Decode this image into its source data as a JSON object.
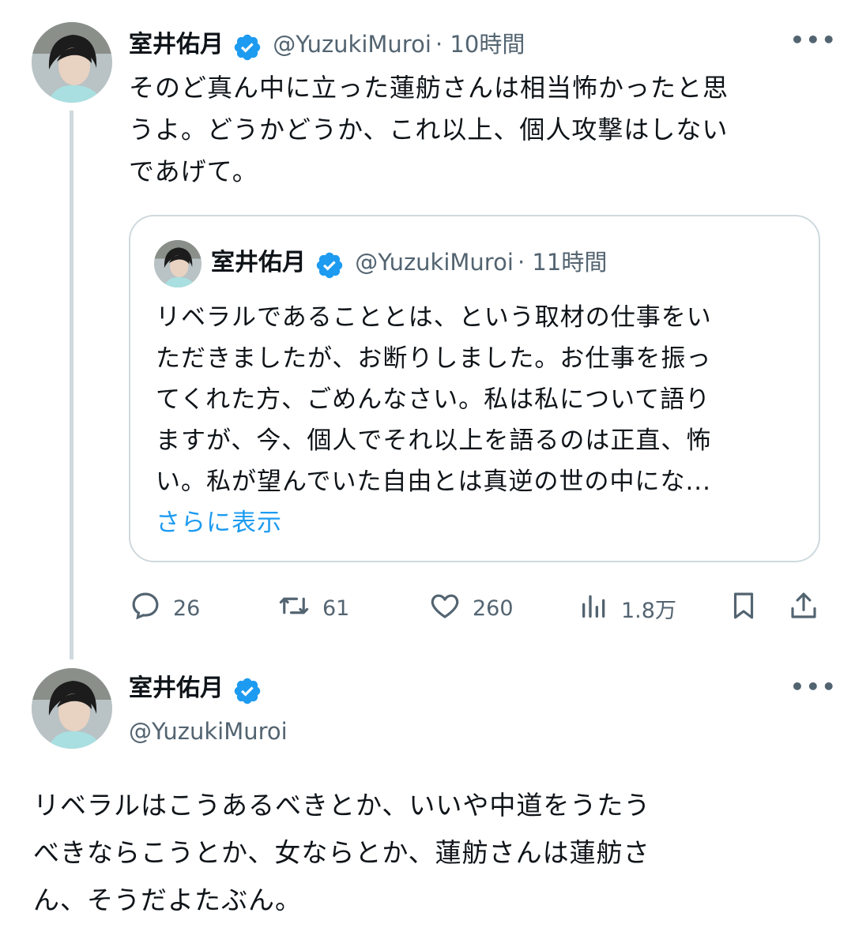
{
  "tweet1": {
    "display_name": "室井佑月",
    "handle": "@YuzukiMuroi",
    "time": "· 10時間",
    "text_lines": [
      "そのど真ん中に立った蓮舫さんは相当怖かったと思",
      "うよ。どうかどうか、これ以上、個人攻撃はしない",
      "であげて。"
    ],
    "quote": {
      "display_name": "室井佑月",
      "handle": "@YuzukiMuroi",
      "time": "· 11時間",
      "text_lines": [
        "リベラルであることとは、という取材の仕事をい",
        "ただきましたが、お断りしました。お仕事を振っ",
        "てくれた方、ごめんなさい。私は私について語り",
        "ますが、今、個人でそれ以上を語るのは正直、怖",
        "い。私が望んでいた自由とは真逆の世の中にな..."
      ],
      "show_more": "さらに表示"
    },
    "actions": {
      "replies": "26",
      "retweets": "61",
      "likes": "260",
      "views": "1.8万"
    }
  },
  "tweet2": {
    "display_name": "室井佑月",
    "handle": "@YuzukiMuroi",
    "text_lines": [
      "リベラルはこうあるべきとか、いいや中道をうたう",
      "べきならこうとか、女ならとか、蓮舫さんは蓮舫さ",
      "ん、そうだよたぶん。"
    ]
  },
  "colors": {
    "verified_blue": "#1d9bf0",
    "link_blue": "#1d9bf0",
    "secondary_text": "#536471",
    "border": "#cfd9de"
  },
  "icons": {
    "verified": "verified-badge-icon",
    "reply": "reply-icon",
    "retweet": "retweet-icon",
    "like": "heart-icon",
    "views": "views-chart-icon",
    "bookmark": "bookmark-icon",
    "share": "share-icon",
    "more": "more-dots-icon"
  }
}
